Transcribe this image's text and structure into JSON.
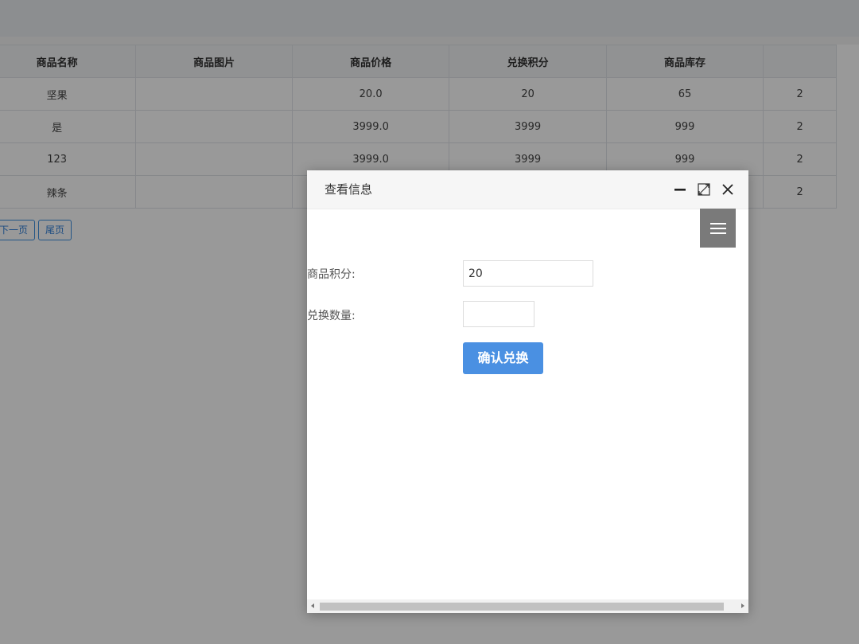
{
  "table": {
    "headers": [
      "商品名称",
      "商品图片",
      "商品价格",
      "兑换积分",
      "商品库存",
      ""
    ],
    "rows": [
      [
        "坚果",
        "",
        "20.0",
        "20",
        "65",
        "2"
      ],
      [
        "是",
        "",
        "3999.0",
        "3999",
        "999",
        "2"
      ],
      [
        "123",
        "",
        "3999.0",
        "3999",
        "999",
        "2"
      ],
      [
        "辣条",
        "",
        "",
        "",
        "",
        "2"
      ]
    ]
  },
  "pager": {
    "next": "下一页",
    "last": "尾页"
  },
  "dialog": {
    "title": "查看信息",
    "points_label": "商品积分:",
    "points_value": "20",
    "quantity_label": "兑换数量:",
    "quantity_value": "",
    "confirm_label": "确认兑换"
  }
}
